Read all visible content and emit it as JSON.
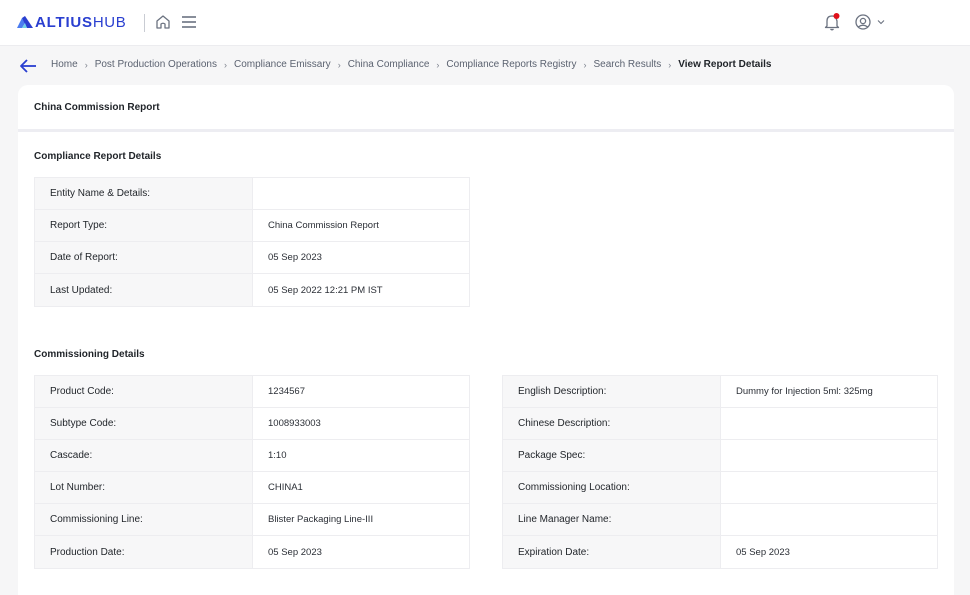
{
  "header": {
    "brand_bold": "ALTIUS",
    "brand_light": "HUB",
    "icons": {
      "logo": "altius-logo-icon",
      "home": "home-icon",
      "menu": "hamburger-menu-icon",
      "notifications": "bell-icon",
      "user": "user-circle-icon",
      "user_menu": "chevron-down-icon"
    },
    "notification_dot_color": "#e0101a",
    "brand_color": "#2a3fd0"
  },
  "breadcrumb": {
    "back_icon": "arrow-left-icon",
    "separator": "›",
    "items": [
      {
        "label": "Home"
      },
      {
        "label": "Post Production Operations"
      },
      {
        "label": "Compliance Emissary"
      },
      {
        "label": "China Compliance"
      },
      {
        "label": "Compliance Reports Registry"
      },
      {
        "label": "Search Results"
      },
      {
        "label": "View Report Details"
      }
    ]
  },
  "card": {
    "title": "China Commission Report"
  },
  "compliance_report_details": {
    "title": "Compliance Report Details",
    "rows": [
      {
        "label": "Entity Name & Details:",
        "value": ""
      },
      {
        "label": "Report Type:",
        "value": "China Commission Report"
      },
      {
        "label": "Date of Report:",
        "value": "05 Sep 2023"
      },
      {
        "label": "Last Updated:",
        "value": "05 Sep 2022 12:21 PM IST"
      }
    ]
  },
  "commissioning_details": {
    "title": "Commissioning Details",
    "left_rows": [
      {
        "label": "Product Code:",
        "value": "1234567"
      },
      {
        "label": "Subtype Code:",
        "value": "1008933003"
      },
      {
        "label": "Cascade:",
        "value": "1:10"
      },
      {
        "label": "Lot Number:",
        "value": "CHINA1"
      },
      {
        "label": "Commissioning Line:",
        "value": "Blister Packaging Line-III"
      },
      {
        "label": "Production Date:",
        "value": "05 Sep 2023"
      }
    ],
    "right_rows": [
      {
        "label": "English Description:",
        "value": "Dummy for Injection 5ml: 325mg"
      },
      {
        "label": "Chinese Description:",
        "value": ""
      },
      {
        "label": "Package Spec:",
        "value": ""
      },
      {
        "label": "Commissioning Location:",
        "value": ""
      },
      {
        "label": "Line Manager Name:",
        "value": ""
      },
      {
        "label": "Expiration Date:",
        "value": "05 Sep 2023"
      }
    ]
  }
}
